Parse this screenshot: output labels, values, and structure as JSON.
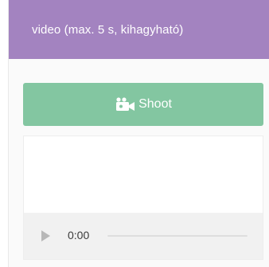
{
  "card": {
    "title": "video (max. 5 s, kihagyható)",
    "header_color": "#a383c0"
  },
  "shoot_button": {
    "label": "Shoot",
    "icon": "video-camera-icon",
    "color": "#83c6a1"
  },
  "player": {
    "play_icon": "play-icon",
    "current_time": "0:00",
    "progress": 0
  }
}
